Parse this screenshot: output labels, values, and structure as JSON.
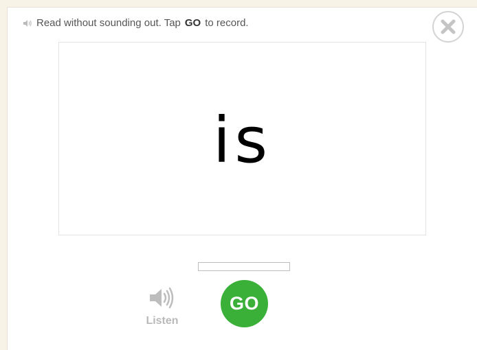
{
  "instruction": {
    "prefix": "Read without sounding out. Tap",
    "keyword": "GO",
    "suffix": "to record."
  },
  "card": {
    "word": "is"
  },
  "recording": {
    "progress_fraction": 0
  },
  "controls": {
    "listen_label": "Listen",
    "go_label": "GO"
  },
  "icons": {
    "close": "close-icon",
    "speaker": "speaker-icon"
  },
  "colors": {
    "go_button": "#3ab039",
    "background": "#f7f3e6"
  }
}
